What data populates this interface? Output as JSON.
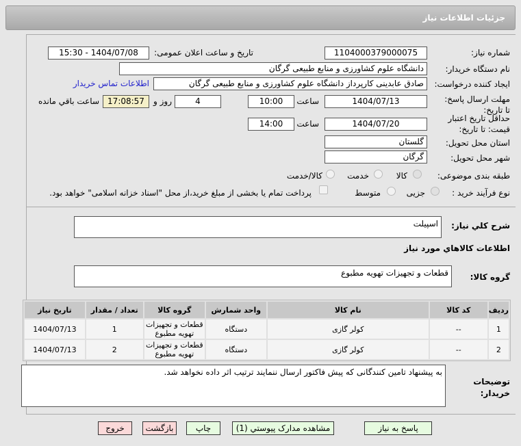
{
  "header": {
    "title": "جزئیات اطلاعات نیاز"
  },
  "form": {
    "need_number_label": "شماره نیاز:",
    "need_number": "1104000379000075",
    "announce_label": "تاریخ و ساعت اعلان عمومی:",
    "announce_value": "1404/07/08 - 15:30",
    "buyer_label": "نام دستگاه خريدار:",
    "buyer": "دانشگاه علوم کشاورزی و منابع طبیعی گرگان",
    "creator_label": "ایجاد کننده درخواست:",
    "creator": "صادق عابدینی کارپرداز دانشگاه علوم کشاورزی و منابع طبیعی گرگان",
    "contact_link": "اطلاعات تماس خريدار",
    "deadline_label": "مهلت ارسال پاسخ: تا تاریخ:",
    "deadline_date": "1404/07/13",
    "time_label": "ساعت",
    "deadline_time": "10:00",
    "days": "4",
    "days_label": "روز و",
    "remaining": "17:08:57",
    "remaining_label": "ساعت باقي مانده",
    "validity_label": "حداقل تاریخ اعتبار قیمت: تا تاریخ:",
    "validity_date": "1404/07/20",
    "validity_time": "14:00",
    "province_label": "استان محل تحویل:",
    "province": "گلستان",
    "city_label": "شهر محل تحویل:",
    "city": "گرگان",
    "category_label": "طبقه بندی موضوعی:",
    "category_options": [
      "کالا",
      "خدمت",
      "کالا/خدمت"
    ],
    "category_selected": "کالا",
    "process_label": "نوع فرآیند خرید :",
    "process_options": [
      "جزیی",
      "متوسط"
    ],
    "process_selected": "جزیی",
    "payment_note": "پرداخت تمام یا بخشی از مبلغ خرید،از محل \"اسناد خزانه اسلامی\" خواهد بود."
  },
  "summary_label": "شرح کلي نياز:",
  "summary": "اسپیلت",
  "goods_title": "اطلاعات کالاهاي مورد نياز",
  "group_label": "گروه کالا:",
  "group": "قطعات و تجهیزات تهویه مطبوع",
  "table": {
    "headers": [
      "ردیف",
      "کد کالا",
      "نام کالا",
      "واحد شمارش",
      "گروه کالا",
      "تعداد / مقدار",
      "تاریخ نیاز"
    ],
    "rows": [
      [
        "1",
        "--",
        "کولر گازی",
        "دستگاه",
        "قطعات و تجهیزات تهویه مطبوع",
        "1",
        "1404/07/13"
      ],
      [
        "2",
        "--",
        "کولر گازی",
        "دستگاه",
        "قطعات و تجهیزات تهویه مطبوع",
        "2",
        "1404/07/13"
      ]
    ]
  },
  "notes_label": "توضیحات خریدار:",
  "notes": "به پیشنهاد تامین کنندگانی که پیش فاکتور ارسال ننمایند ترتیب اثر داده نخواهد شد.",
  "buttons": {
    "reply": "پاسخ به نیاز",
    "attachments": "مشاهده مدارک پیوستي (1)",
    "print": "چاپ",
    "back": "بازگشت",
    "exit": "خروج"
  }
}
